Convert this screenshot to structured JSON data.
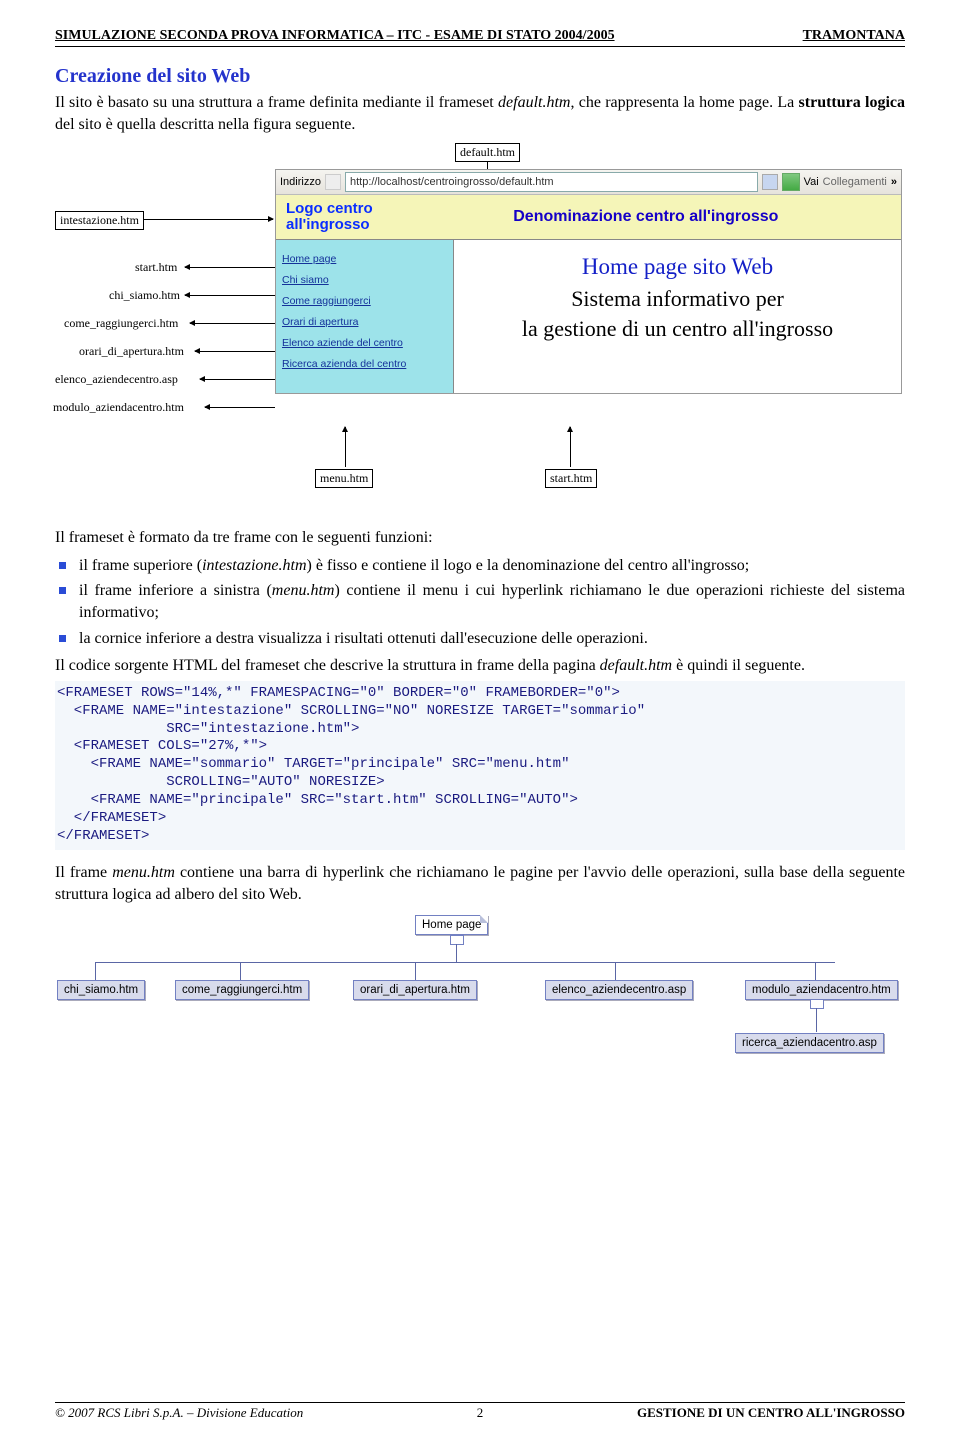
{
  "header": {
    "left": "SIMULAZIONE SECONDA PROVA INFORMATICA – ITC - ESAME DI STATO 2004/2005",
    "right": "TRAMONTANA"
  },
  "section_title": "Creazione del sito Web",
  "para1_a": "Il sito è basato su una struttura a frame definita mediante il frameset ",
  "para1_b": "default.htm",
  "para1_c": ", che rappresenta la home page. La ",
  "para1_d": "struttura logica",
  "para1_e": " del sito è quella descritta nella figura seguente.",
  "mock": {
    "default": "default.htm",
    "intestazione": "intestazione.htm",
    "menu": "menu.htm",
    "startb": "start.htm",
    "addr_label": "Indirizzo",
    "addr": "http://localhost/centroingrosso/default.htm",
    "go": "Vai",
    "links": "Collegamenti",
    "logo1": "Logo centro",
    "logo2": "all'ingrosso",
    "center": "Denominazione centro all'ingrosso",
    "menuPages": {
      "start": "start.htm",
      "chi": "chi_siamo.htm",
      "come": "come_raggiungerci.htm",
      "orari": "orari_di_apertura.htm",
      "elenco": "elenco_aziendecentro.asp",
      "modulo": "modulo_aziendacentro.htm"
    },
    "menuLinks": {
      "home": "Home page",
      "chi": "Chi siamo",
      "come": "Come raggiungerci",
      "orari": "Orari di apertura",
      "elenco": "Elenco aziende del centro",
      "ricerca": "Ricerca azienda del centro"
    },
    "main": {
      "t1": "Home page sito Web",
      "t2a": "Sistema informativo per",
      "t2b": "la gestione di un centro all'ingrosso"
    }
  },
  "para2": "Il frameset è formato da tre frame con le seguenti funzioni:",
  "bullets": {
    "b1a": "il frame superiore (",
    "b1b": "intestazione.htm",
    "b1c": ") è fisso e contiene il logo e la denominazione del centro all'ingrosso;",
    "b2a": "il frame inferiore a sinistra (",
    "b2b": "menu.htm",
    "b2c": ") contiene il menu i cui hyperlink richiamano le due operazioni richieste del sistema informativo;",
    "b3": "la cornice inferiore a destra visualizza i risultati ottenuti dall'esecuzione delle operazioni."
  },
  "para3a": "Il codice sorgente HTML del frameset che descrive la struttura in frame della pagina ",
  "para3b": "default.htm",
  "para3c": " è quindi il seguente.",
  "code": "<FRAMESET ROWS=\"14%,*\" FRAMESPACING=\"0\" BORDER=\"0\" FRAMEBORDER=\"0\">\n  <FRAME NAME=\"intestazione\" SCROLLING=\"NO\" NORESIZE TARGET=\"sommario\"\n             SRC=\"intestazione.htm\">\n  <FRAMESET COLS=\"27%,*\">\n    <FRAME NAME=\"sommario\" TARGET=\"principale\" SRC=\"menu.htm\"\n             SCROLLING=\"AUTO\" NORESIZE>\n    <FRAME NAME=\"principale\" SRC=\"start.htm\" SCROLLING=\"AUTO\">\n  </FRAMESET>\n</FRAMESET>",
  "para4a": "Il frame ",
  "para4b": "menu.htm",
  "para4c": " contiene una barra di hyperlink che richiamano le pagine per l'avvio delle operazioni, sulla base della seguente struttura logica ad albero del sito Web.",
  "tree": {
    "root": "Home page",
    "chi": "chi_siamo.htm",
    "come": "come_raggiungerci.htm",
    "orari": "orari_di_apertura.htm",
    "elenco": "elenco_aziendecentro.asp",
    "modulo": "modulo_aziendacentro.htm",
    "ricerca": "ricerca_aziendacentro.asp"
  },
  "footer": {
    "left": "© 2007 RCS Libri S.p.A. – Divisione Education",
    "page": "2",
    "right": "GESTIONE DI UN CENTRO ALL'INGROSSO"
  }
}
